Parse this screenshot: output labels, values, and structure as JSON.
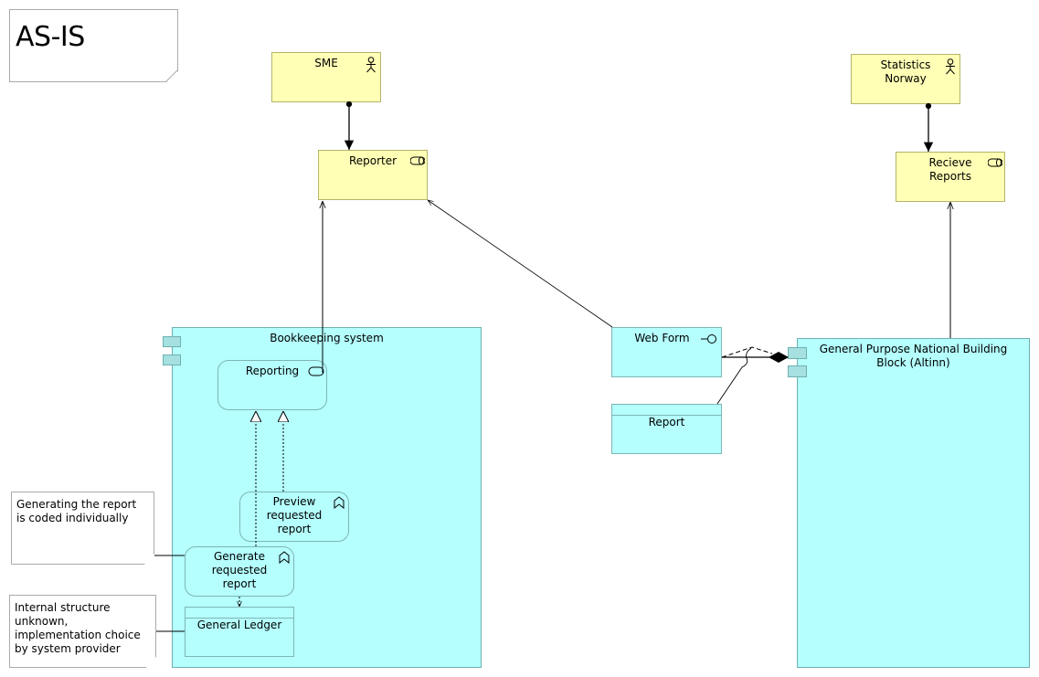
{
  "diagram": {
    "title": "AS-IS",
    "colors": {
      "business": "#ffffb5",
      "application": "#b5ffff",
      "note": "#ffffff"
    },
    "elements": {
      "sme": {
        "label": "SME",
        "type": "business-actor",
        "icon": "actor-icon"
      },
      "reporter": {
        "label": "Reporter",
        "type": "business-role",
        "icon": "role-icon"
      },
      "statistics_norway": {
        "label": "Statistics Norway",
        "type": "business-actor",
        "icon": "actor-icon"
      },
      "recieve_reports": {
        "label": "Recieve Reports",
        "type": "business-role",
        "icon": "role-icon"
      },
      "bookkeeping_system": {
        "label": "Bookkeeping system",
        "type": "application-component",
        "icon": "component-icon"
      },
      "reporting": {
        "label": "Reporting",
        "type": "application-service",
        "icon": "service-icon"
      },
      "preview_requested_report": {
        "label": "Preview requested report",
        "type": "application-function",
        "icon": "function-icon"
      },
      "generate_requested_report": {
        "label": "Generate requested report",
        "type": "application-function",
        "icon": "function-icon"
      },
      "general_ledger": {
        "label": "General Ledger",
        "type": "data-object"
      },
      "web_form": {
        "label": "Web Form",
        "type": "application-interface",
        "icon": "interface-icon"
      },
      "report": {
        "label": "Report",
        "type": "data-object"
      },
      "altinn": {
        "label": "General Purpose National Building Block (Altinn)",
        "type": "application-component",
        "icon": "component-icon"
      }
    },
    "notes": [
      {
        "text": "Generating the report is coded individually"
      },
      {
        "text": "Internal structure unknown, implementation choice by system provider"
      }
    ],
    "relationships": [
      {
        "from": "sme",
        "to": "reporter",
        "type": "assignment"
      },
      {
        "from": "statistics_norway",
        "to": "recieve_reports",
        "type": "assignment"
      },
      {
        "from": "reporting",
        "to": "reporter",
        "type": "serving"
      },
      {
        "from": "web_form",
        "to": "reporter",
        "type": "serving"
      },
      {
        "from": "altinn",
        "to": "recieve_reports",
        "type": "serving"
      },
      {
        "from": "altinn",
        "to": "web_form",
        "type": "composition"
      },
      {
        "from": "report",
        "to": "altinn",
        "type": "association"
      },
      {
        "from": "generate_requested_report",
        "to": "reporting",
        "type": "realization"
      },
      {
        "from": "preview_requested_report",
        "to": "reporting",
        "type": "realization"
      },
      {
        "from": "generate_requested_report",
        "to": "general_ledger",
        "type": "access"
      }
    ]
  }
}
